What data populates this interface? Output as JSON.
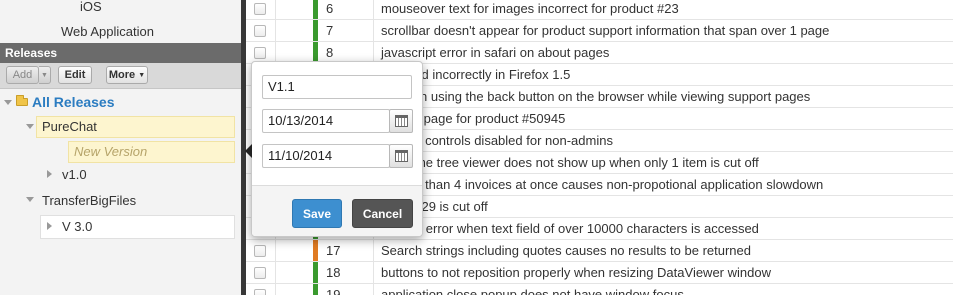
{
  "sidebar": {
    "nav_items": [
      "iOS",
      "Web Application"
    ],
    "releases_header": "Releases",
    "toolbar": {
      "add_label": "Add",
      "edit_label": "Edit",
      "more_label": "More"
    },
    "tree": {
      "root": "All Releases",
      "purechat": "PureChat",
      "new_version_placeholder": "New Version",
      "v10": "v1.0",
      "transferbigfiles": "TransferBigFiles",
      "v30": "V 3.0"
    }
  },
  "table": {
    "rows": [
      {
        "id": "6",
        "title": "mouseover text for images incorrect for product #23",
        "status_color": "#3a9a2e"
      },
      {
        "id": "7",
        "title": "scrollbar doesn't appear for product support information that span over 1 page",
        "status_color": "#3a9a2e"
      },
      {
        "id": "8",
        "title": "javascript error in safari on about pages",
        "status_color": "#3a9a2e"
      },
      {
        "id": "",
        "title": "endered incorrectly in Firefox 1.5",
        "status_color": "#3a9a2e"
      },
      {
        "id": "",
        "title": "or when using the back button on the browser while viewing support pages",
        "status_color": "#3a9a2e"
      },
      {
        "id": "",
        "title": "to load page for product #50945",
        "status_color": "#3a9a2e"
      },
      {
        "id": "",
        "title": "nt form controls disabled for non-admins",
        "status_color": "#3a9a2e"
      },
      {
        "id": "",
        "title": "ar for the tree viewer does not show up when only 1 item is cut off",
        "status_color": "#3a9a2e"
      },
      {
        "id": "",
        "title": "g more than 4 invoices at once causes non-propotional application slowdown",
        "status_color": "#3a9a2e"
      },
      {
        "id": "",
        "title": "for #2329 is cut off",
        "status_color": "#3a9a2e"
      },
      {
        "id": "",
        "title": "verflow error when text field of over 10000 characters is accessed",
        "status_color": "#3a9a2e"
      },
      {
        "id": "17",
        "title": "Search strings including quotes causes no results to be returned",
        "status_color": "#e07b22"
      },
      {
        "id": "18",
        "title": "buttons to not reposition properly when resizing DataViewer window",
        "status_color": "#3a9a2e"
      },
      {
        "id": "19",
        "title": "application close popup does not have window focus",
        "status_color": "#3a9a2e"
      }
    ]
  },
  "popup": {
    "name_value": "V1.1",
    "start_date": "10/13/2014",
    "end_date": "11/10/2014",
    "save_label": "Save",
    "cancel_label": "Cancel"
  },
  "icons": [
    "folder-icon",
    "calendar-icon",
    "expand-triangle-icon",
    "collapse-triangle-icon",
    "dropdown-caret-icon"
  ]
}
